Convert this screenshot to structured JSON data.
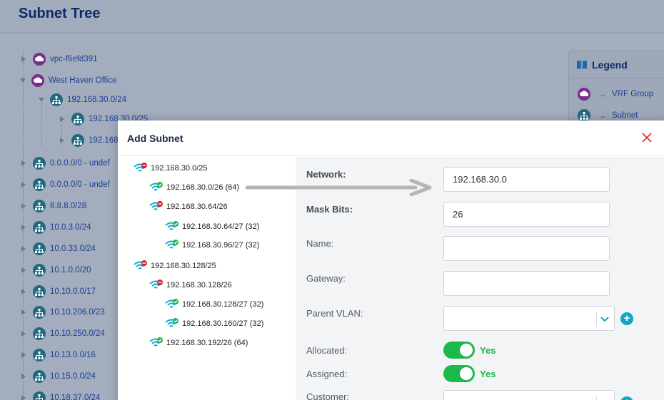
{
  "page": {
    "title": "Subnet Tree"
  },
  "tree": {
    "nodes": [
      {
        "label": "vpc-f6efd391",
        "type": "vrf"
      },
      {
        "label": "West Haven Office",
        "type": "vrf"
      },
      {
        "label": "192.168.30.0/24",
        "type": "subnet"
      },
      {
        "label": "192.168.30.0/25",
        "type": "subnet"
      },
      {
        "label": "192.168",
        "type": "subnet"
      },
      {
        "label": "0.0.0.0/0 - undef",
        "type": "subnet"
      },
      {
        "label": "0.0.0.0/0 - undef",
        "type": "subnet"
      },
      {
        "label": "8.8.8.0/28",
        "type": "subnet"
      },
      {
        "label": "10.0.3.0/24",
        "type": "subnet"
      },
      {
        "label": "10.0.33.0/24",
        "type": "subnet"
      },
      {
        "label": "10.1.0.0/20",
        "type": "subnet"
      },
      {
        "label": "10.10.0.0/17",
        "type": "subnet"
      },
      {
        "label": "10.10.206.0/23",
        "type": "subnet"
      },
      {
        "label": "10.10.250.0/24",
        "type": "subnet"
      },
      {
        "label": "10.13.0.0/16",
        "type": "subnet"
      },
      {
        "label": "10.15.0.0/24",
        "type": "subnet"
      },
      {
        "label": "10.18.37.0/24",
        "type": "subnet"
      }
    ]
  },
  "legend": {
    "title": "Legend",
    "items": [
      {
        "label": "VRF Group",
        "icon": "vrf-group-icon"
      },
      {
        "label": "Subnet",
        "icon": "subnet-icon"
      }
    ]
  },
  "modal": {
    "title": "Add Subnet",
    "subnet_tree": [
      {
        "label": "192.168.30.0/25",
        "status": "used"
      },
      {
        "label": "192.168.30.0/26 (64)",
        "status": "free"
      },
      {
        "label": "192.168.30.64/26",
        "status": "used"
      },
      {
        "label": "192.168.30.64/27 (32)",
        "status": "free"
      },
      {
        "label": "192.168.30.96/27 (32)",
        "status": "free"
      },
      {
        "label": "192.168.30.128/25",
        "status": "used"
      },
      {
        "label": "192.168.30.128/26",
        "status": "used"
      },
      {
        "label": "192.168.30.128/27 (32)",
        "status": "free"
      },
      {
        "label": "192.168.30.160/27 (32)",
        "status": "free"
      },
      {
        "label": "192.168.30.192/26 (64)",
        "status": "free"
      }
    ],
    "form": {
      "network_label": "Network:",
      "network_value": "192.168.30.0",
      "mask_label": "Mask Bits:",
      "mask_value": "26",
      "name_label": "Name:",
      "name_value": "",
      "gateway_label": "Gateway:",
      "gateway_value": "",
      "parent_vlan_label": "Parent VLAN:",
      "parent_vlan_value": "",
      "allocated_label": "Allocated:",
      "allocated_state": "Yes",
      "assigned_label": "Assigned:",
      "assigned_state": "Yes",
      "customer_label": "Customer:"
    }
  },
  "colors": {
    "accent": "#12a7c7",
    "toggle_on": "#1bb84a",
    "close": "#e0282e",
    "vrf_icon": "#7b2d8f",
    "subnet_icon": "#1f6a80"
  }
}
